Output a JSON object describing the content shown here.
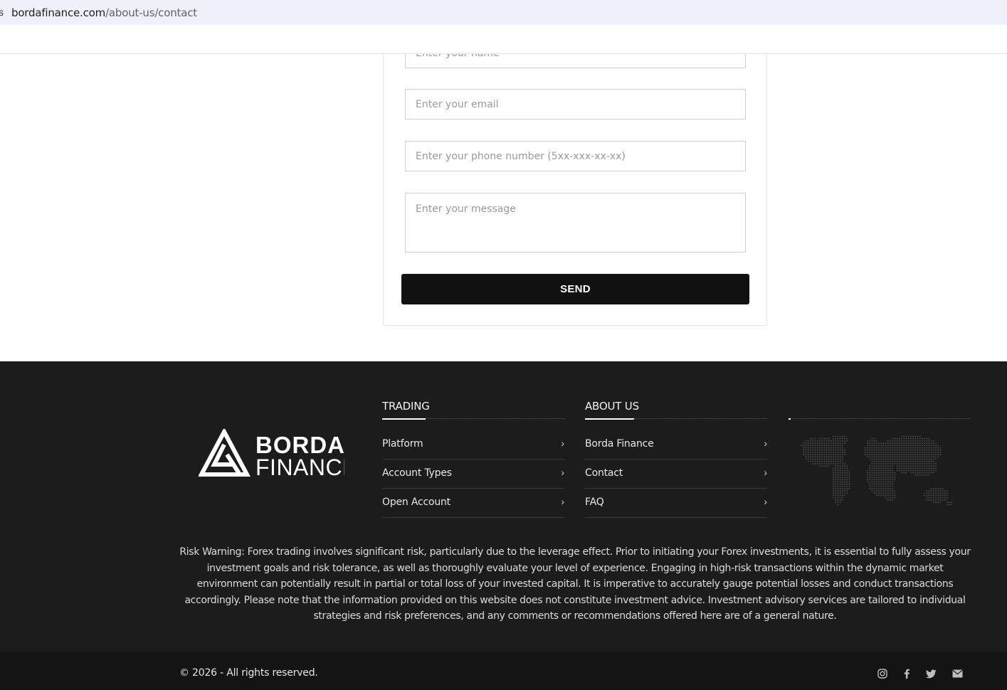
{
  "browser": {
    "edge_glyph": "s",
    "url_domain": "bordafinance.com",
    "url_path": "/about-us/contact"
  },
  "contact_form": {
    "name_placeholder": "Enter your name",
    "email_placeholder": "Enter your email",
    "phone_placeholder": "Enter your phone number (5xx-xxx-xx-xx)",
    "message_placeholder": "Enter your message",
    "send_label": "SEND"
  },
  "footer": {
    "logo": {
      "line1": "BORDA",
      "line2": "FINANCE"
    },
    "trading": {
      "title": "TRADING",
      "items": [
        {
          "label": "Platform"
        },
        {
          "label": "Account Types"
        },
        {
          "label": "Open Account"
        }
      ]
    },
    "about": {
      "title": "ABOUT US",
      "items": [
        {
          "label": "Borda Finance"
        },
        {
          "label": "Contact"
        },
        {
          "label": "FAQ"
        }
      ]
    },
    "map_icon": "world-map-dotted",
    "risk_warning": "Risk Warning: Forex trading involves significant risk, particularly due to the leverage effect. Prior to initiating your Forex investments, it is essential to fully assess your investment goals and risk tolerance, as well as thoroughly evaluate your level of experience. Engaging in high-risk transactions within the dynamic market environment can potentially result in partial or total loss of your invested capital. It is imperative to accurately gauge potential losses and conduct transactions accordingly. Please note that the information provided on this website does not constitute investment advice. Investment advisory services are tailored to individual strategies and risk preferences, and any comments or recommendations offered here are of a general nature.",
    "copyright": "© 2026 - All rights reserved.",
    "social_icons": [
      "instagram-icon",
      "facebook-icon",
      "twitter-icon",
      "email-icon"
    ]
  },
  "colors": {
    "footer_bg": "#1c1c1c",
    "bottom_bar_bg": "#141414",
    "button_bg": "#111111",
    "address_bar_bg": "#eef1fa"
  }
}
